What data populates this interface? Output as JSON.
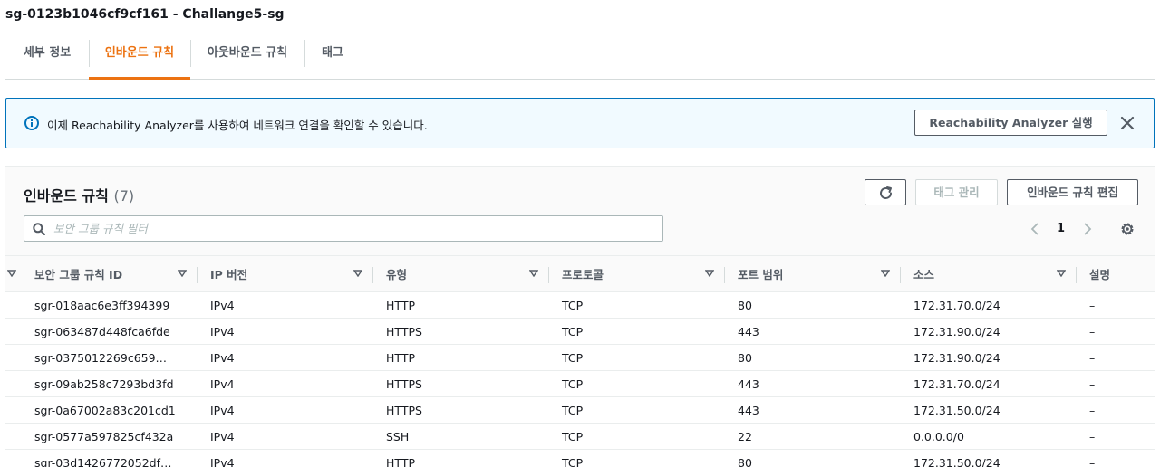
{
  "page_title": "sg-0123b1046cf9cf161 - Challange5-sg",
  "tabs": [
    "세부 정보",
    "인바운드 규칙",
    "아웃바운드 규칙",
    "태그"
  ],
  "active_tab": "인바운드 규칙",
  "alert": {
    "message": "이제 Reachability Analyzer를 사용하여 네트워크 연결을 확인할 수 있습니다.",
    "action_label": "Reachability Analyzer 실행"
  },
  "panel": {
    "title": "인바운드 규칙",
    "count": "(7)",
    "tag_manage_label": "태그 관리",
    "edit_label": "인바운드 규칙 편집",
    "search_placeholder": "보안 그룹 규칙 필터",
    "page": "1"
  },
  "columns": [
    "보안 그룹 규칙 ID",
    "IP 버전",
    "유형",
    "프로토콜",
    "포트 범위",
    "소스",
    "설명"
  ],
  "rows": [
    [
      "sgr-018aac6e3ff394399",
      "IPv4",
      "HTTP",
      "TCP",
      "80",
      "172.31.70.0/24",
      "–"
    ],
    [
      "sgr-063487d448fca6fde",
      "IPv4",
      "HTTPS",
      "TCP",
      "443",
      "172.31.90.0/24",
      "–"
    ],
    [
      "sgr-0375012269c659…",
      "IPv4",
      "HTTP",
      "TCP",
      "80",
      "172.31.90.0/24",
      "–"
    ],
    [
      "sgr-09ab258c7293bd3fd",
      "IPv4",
      "HTTPS",
      "TCP",
      "443",
      "172.31.70.0/24",
      "–"
    ],
    [
      "sgr-0a67002a83c201cd1",
      "IPv4",
      "HTTPS",
      "TCP",
      "443",
      "172.31.50.0/24",
      "–"
    ],
    [
      "sgr-0577a597825cf432a",
      "IPv4",
      "SSH",
      "TCP",
      "22",
      "0.0.0.0/0",
      "–"
    ],
    [
      "sgr-03d1426772052df…",
      "IPv4",
      "HTTP",
      "TCP",
      "80",
      "172.31.50.0/24",
      "–"
    ]
  ],
  "colors": {
    "accent": "#ec7211",
    "info_blue": "#0073bb",
    "alert_bg": "#f1faff",
    "text": "#16191f",
    "muted": "#545b64"
  },
  "icons": [
    "info-icon",
    "close-icon",
    "refresh-icon",
    "search-icon",
    "chevron-left-icon",
    "chevron-right-icon",
    "settings-icon",
    "sort-caret-icon"
  ]
}
